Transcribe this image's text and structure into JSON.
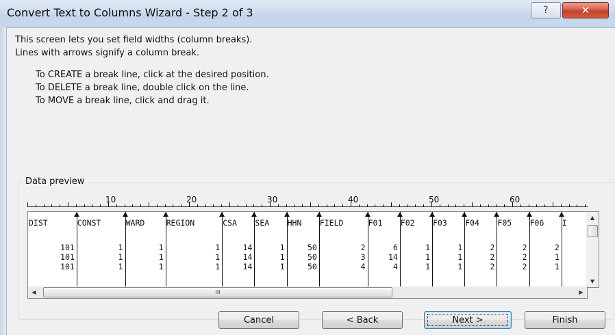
{
  "dialog": {
    "title": "Convert Text to Columns Wizard - Step 2 of 3",
    "help": "?",
    "close": "✕"
  },
  "description": [
    "This screen lets you set field widths (column breaks).",
    "Lines with arrows signify a column break."
  ],
  "instructions": [
    "To CREATE a break line, click at the desired position.",
    "To DELETE a break line, double click on the line.",
    "To MOVE a break line, click and drag it."
  ],
  "preview": {
    "label": "Data preview",
    "ruler": [
      "10",
      "20",
      "30",
      "40",
      "50",
      "60"
    ],
    "headers": [
      "DIST",
      "CONST",
      "WARD",
      "REGION",
      "CSA",
      "SEA",
      "HHN",
      "FIELD",
      "F01",
      "F02",
      "F03",
      "F04",
      "F05",
      "F06",
      "I"
    ],
    "rows": [
      [
        "101",
        "1",
        "1",
        "1",
        "14",
        "1",
        "50",
        "2",
        "6",
        "1",
        "1",
        "2",
        "2",
        "2"
      ],
      [
        "101",
        "1",
        "1",
        "1",
        "14",
        "1",
        "50",
        "3",
        "14",
        "1",
        "1",
        "2",
        "2",
        "1"
      ],
      [
        "101",
        "1",
        "1",
        "1",
        "14",
        "1",
        "50",
        "4",
        "4",
        "1",
        "1",
        "2",
        "2",
        "1"
      ]
    ],
    "hscroll_thumb": "III"
  },
  "buttons": {
    "cancel": "Cancel",
    "back": "< Back",
    "next": "Next >",
    "finish": "Finish"
  }
}
